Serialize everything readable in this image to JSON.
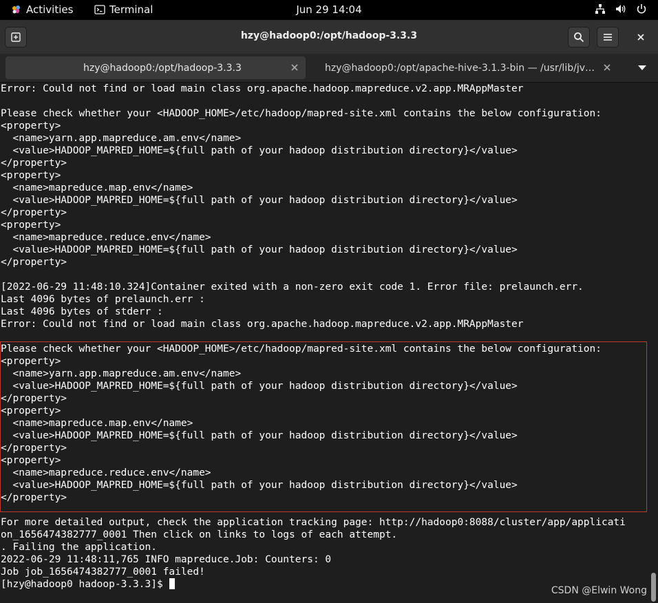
{
  "topbar": {
    "activities": "Activities",
    "app_name": "Terminal",
    "clock": "Jun 29  14:04"
  },
  "window": {
    "title": "hzy@hadoop0:/opt/hadoop-3.3.3"
  },
  "tabs": [
    {
      "label": "hzy@hadoop0:/opt/hadoop-3.3.3"
    },
    {
      "label": "hzy@hadoop0:/opt/apache-hive-3.1.3-bin — /usr/lib/jvm/j..."
    }
  ],
  "terminal": {
    "lines": [
      "Error: Could not find or load main class org.apache.hadoop.mapreduce.v2.app.MRAppMaster",
      "",
      "Please check whether your <HADOOP_HOME>/etc/hadoop/mapred-site.xml contains the below configuration:",
      "<property>",
      "  <name>yarn.app.mapreduce.am.env</name>",
      "  <value>HADOOP_MAPRED_HOME=${full path of your hadoop distribution directory}</value>",
      "</property>",
      "<property>",
      "  <name>mapreduce.map.env</name>",
      "  <value>HADOOP_MAPRED_HOME=${full path of your hadoop distribution directory}</value>",
      "</property>",
      "<property>",
      "  <name>mapreduce.reduce.env</name>",
      "  <value>HADOOP_MAPRED_HOME=${full path of your hadoop distribution directory}</value>",
      "</property>",
      "",
      "[2022-06-29 11:48:10.324]Container exited with a non-zero exit code 1. Error file: prelaunch.err.",
      "Last 4096 bytes of prelaunch.err :",
      "Last 4096 bytes of stderr :",
      "Error: Could not find or load main class org.apache.hadoop.mapreduce.v2.app.MRAppMaster",
      "",
      "Please check whether your <HADOOP_HOME>/etc/hadoop/mapred-site.xml contains the below configuration:",
      "<property>",
      "  <name>yarn.app.mapreduce.am.env</name>",
      "  <value>HADOOP_MAPRED_HOME=${full path of your hadoop distribution directory}</value>",
      "</property>",
      "<property>",
      "  <name>mapreduce.map.env</name>",
      "  <value>HADOOP_MAPRED_HOME=${full path of your hadoop distribution directory}</value>",
      "</property>",
      "<property>",
      "  <name>mapreduce.reduce.env</name>",
      "  <value>HADOOP_MAPRED_HOME=${full path of your hadoop distribution directory}</value>",
      "</property>",
      "",
      "For more detailed output, check the application tracking page: http://hadoop0:8088/cluster/app/applicati",
      "on_1656474382777_0001 Then click on links to logs of each attempt.",
      ". Failing the application.",
      "2022-06-29 11:48:11,765 INFO mapreduce.Job: Counters: 0",
      "Job job_1656474382777_0001 failed!"
    ],
    "prompt": "[hzy@hadoop0 hadoop-3.3.3]$ "
  },
  "watermark": "CSDN @Elwin Wong",
  "colors": {
    "terminal_bg": "#1e1e1e",
    "terminal_fg": "#ffffff",
    "highlight_border": "#c0392b"
  }
}
